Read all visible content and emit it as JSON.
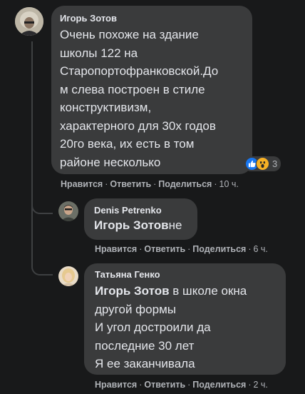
{
  "comments": [
    {
      "author": "Игорь Зотов",
      "lines": [
        "Очень похоже на здание",
        "школы 122 на",
        "Старопортофранковской.До",
        "м слева построен в стиле",
        "конструктивизм,",
        "характерного для 30х годов",
        "20го века, их есть в том",
        "районе несколько"
      ],
      "like_label": "Нравится",
      "reply_label": "Ответить",
      "share_label": "Поделиться",
      "time": "10 ч.",
      "reaction_count": "3",
      "reaction_icons": [
        "like-icon",
        "wow-icon"
      ]
    },
    {
      "author": "Denis Petrenko",
      "mention": "Игорь Зотов",
      "rest": "не",
      "like_label": "Нравится",
      "reply_label": "Ответить",
      "share_label": "Поделиться",
      "time": "6 ч."
    },
    {
      "author": "Татьяна Генко",
      "mention": "Игорь Зотов",
      "first_rest": " в школе окна",
      "lines": [
        "другой формы",
        "И угол достроили да",
        "последние 30 лет",
        "Я ее заканчивала"
      ],
      "like_label": "Нравится",
      "reply_label": "Ответить",
      "share_label": "Поделиться",
      "time": "2 ч."
    }
  ],
  "colors": {
    "background": "#18191a",
    "bubble": "#3a3b3c",
    "text": "#e4e6eb",
    "secondary": "#b0b3b8",
    "like_blue": "#1877f2",
    "wow_yellow": "#f7b125"
  }
}
